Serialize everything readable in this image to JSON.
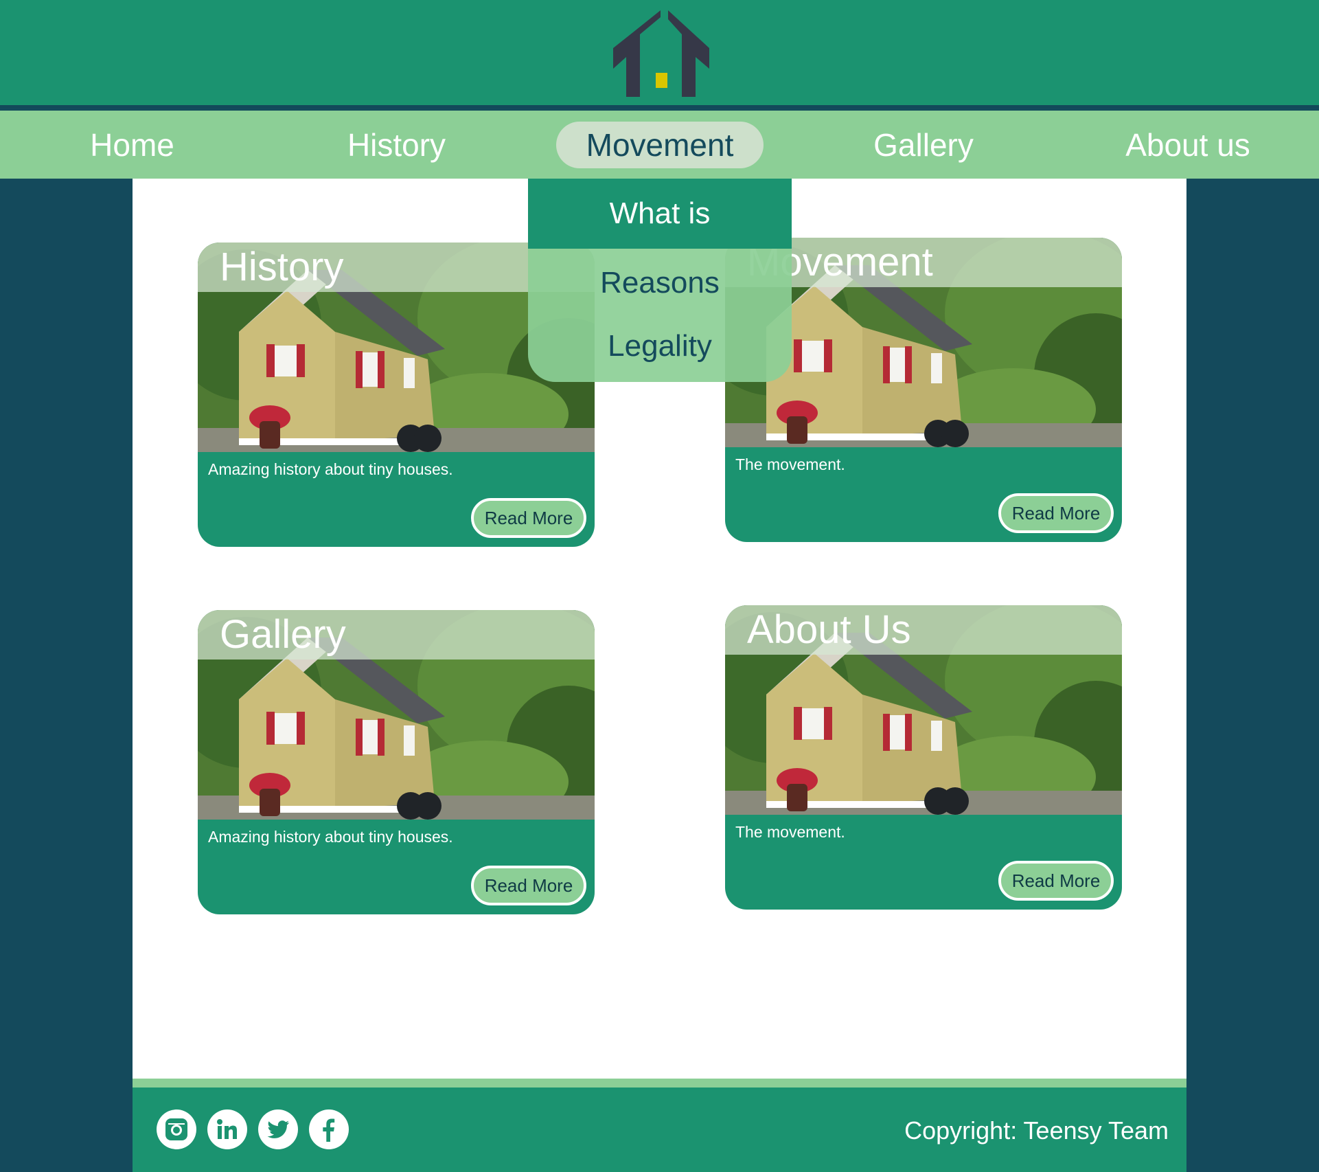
{
  "brand": {
    "logo_icon": "house-logo-icon"
  },
  "nav": {
    "items": [
      {
        "label": "Home",
        "active": false
      },
      {
        "label": "History",
        "active": false
      },
      {
        "label": "Movement",
        "active": true
      },
      {
        "label": "Gallery",
        "active": false
      },
      {
        "label": "About us",
        "active": false
      }
    ],
    "dropdown": [
      "What is",
      "Reasons",
      "Legality"
    ]
  },
  "cards": [
    {
      "title": "History",
      "text": "Amazing history about tiny houses.",
      "button": "Read More"
    },
    {
      "title": "Movement",
      "text": "The movement.",
      "button": "Read More"
    },
    {
      "title": "Gallery",
      "text": "Amazing history about tiny houses.",
      "button": "Read More"
    },
    {
      "title": "About Us",
      "text": "The movement.",
      "button": "Read More"
    }
  ],
  "footer": {
    "social": [
      "instagram-icon",
      "linkedin-icon",
      "twitter-icon",
      "facebook-icon"
    ],
    "copyright": "Copyright: Teensy Team"
  },
  "colors": {
    "header_green": "#1b9370",
    "nav_light_green": "#8ccf96",
    "dark_teal": "#144a5c",
    "active_pill": "#cde0cb",
    "logo_dark": "#3a3d4a",
    "logo_window": "#d7c800"
  }
}
